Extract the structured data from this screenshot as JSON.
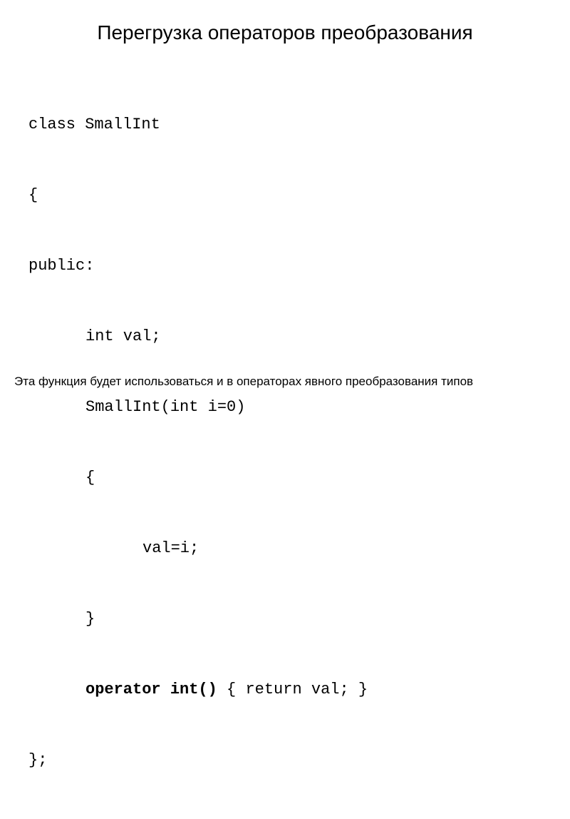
{
  "title": "Перегрузка операторов преобразования",
  "code": {
    "line1": "class SmallInt",
    "line2": "{",
    "line3": "public:",
    "line4": "int val;",
    "line5": "SmallInt(int i=0)",
    "line6": "{",
    "line7": "val=i;",
    "line8": "}",
    "line9_bold": "operator int()",
    "line9_rest": " { return val; }",
    "line10": "};"
  },
  "footer": "Эта функция будет использоваться и в операторах явного преобразования типов"
}
